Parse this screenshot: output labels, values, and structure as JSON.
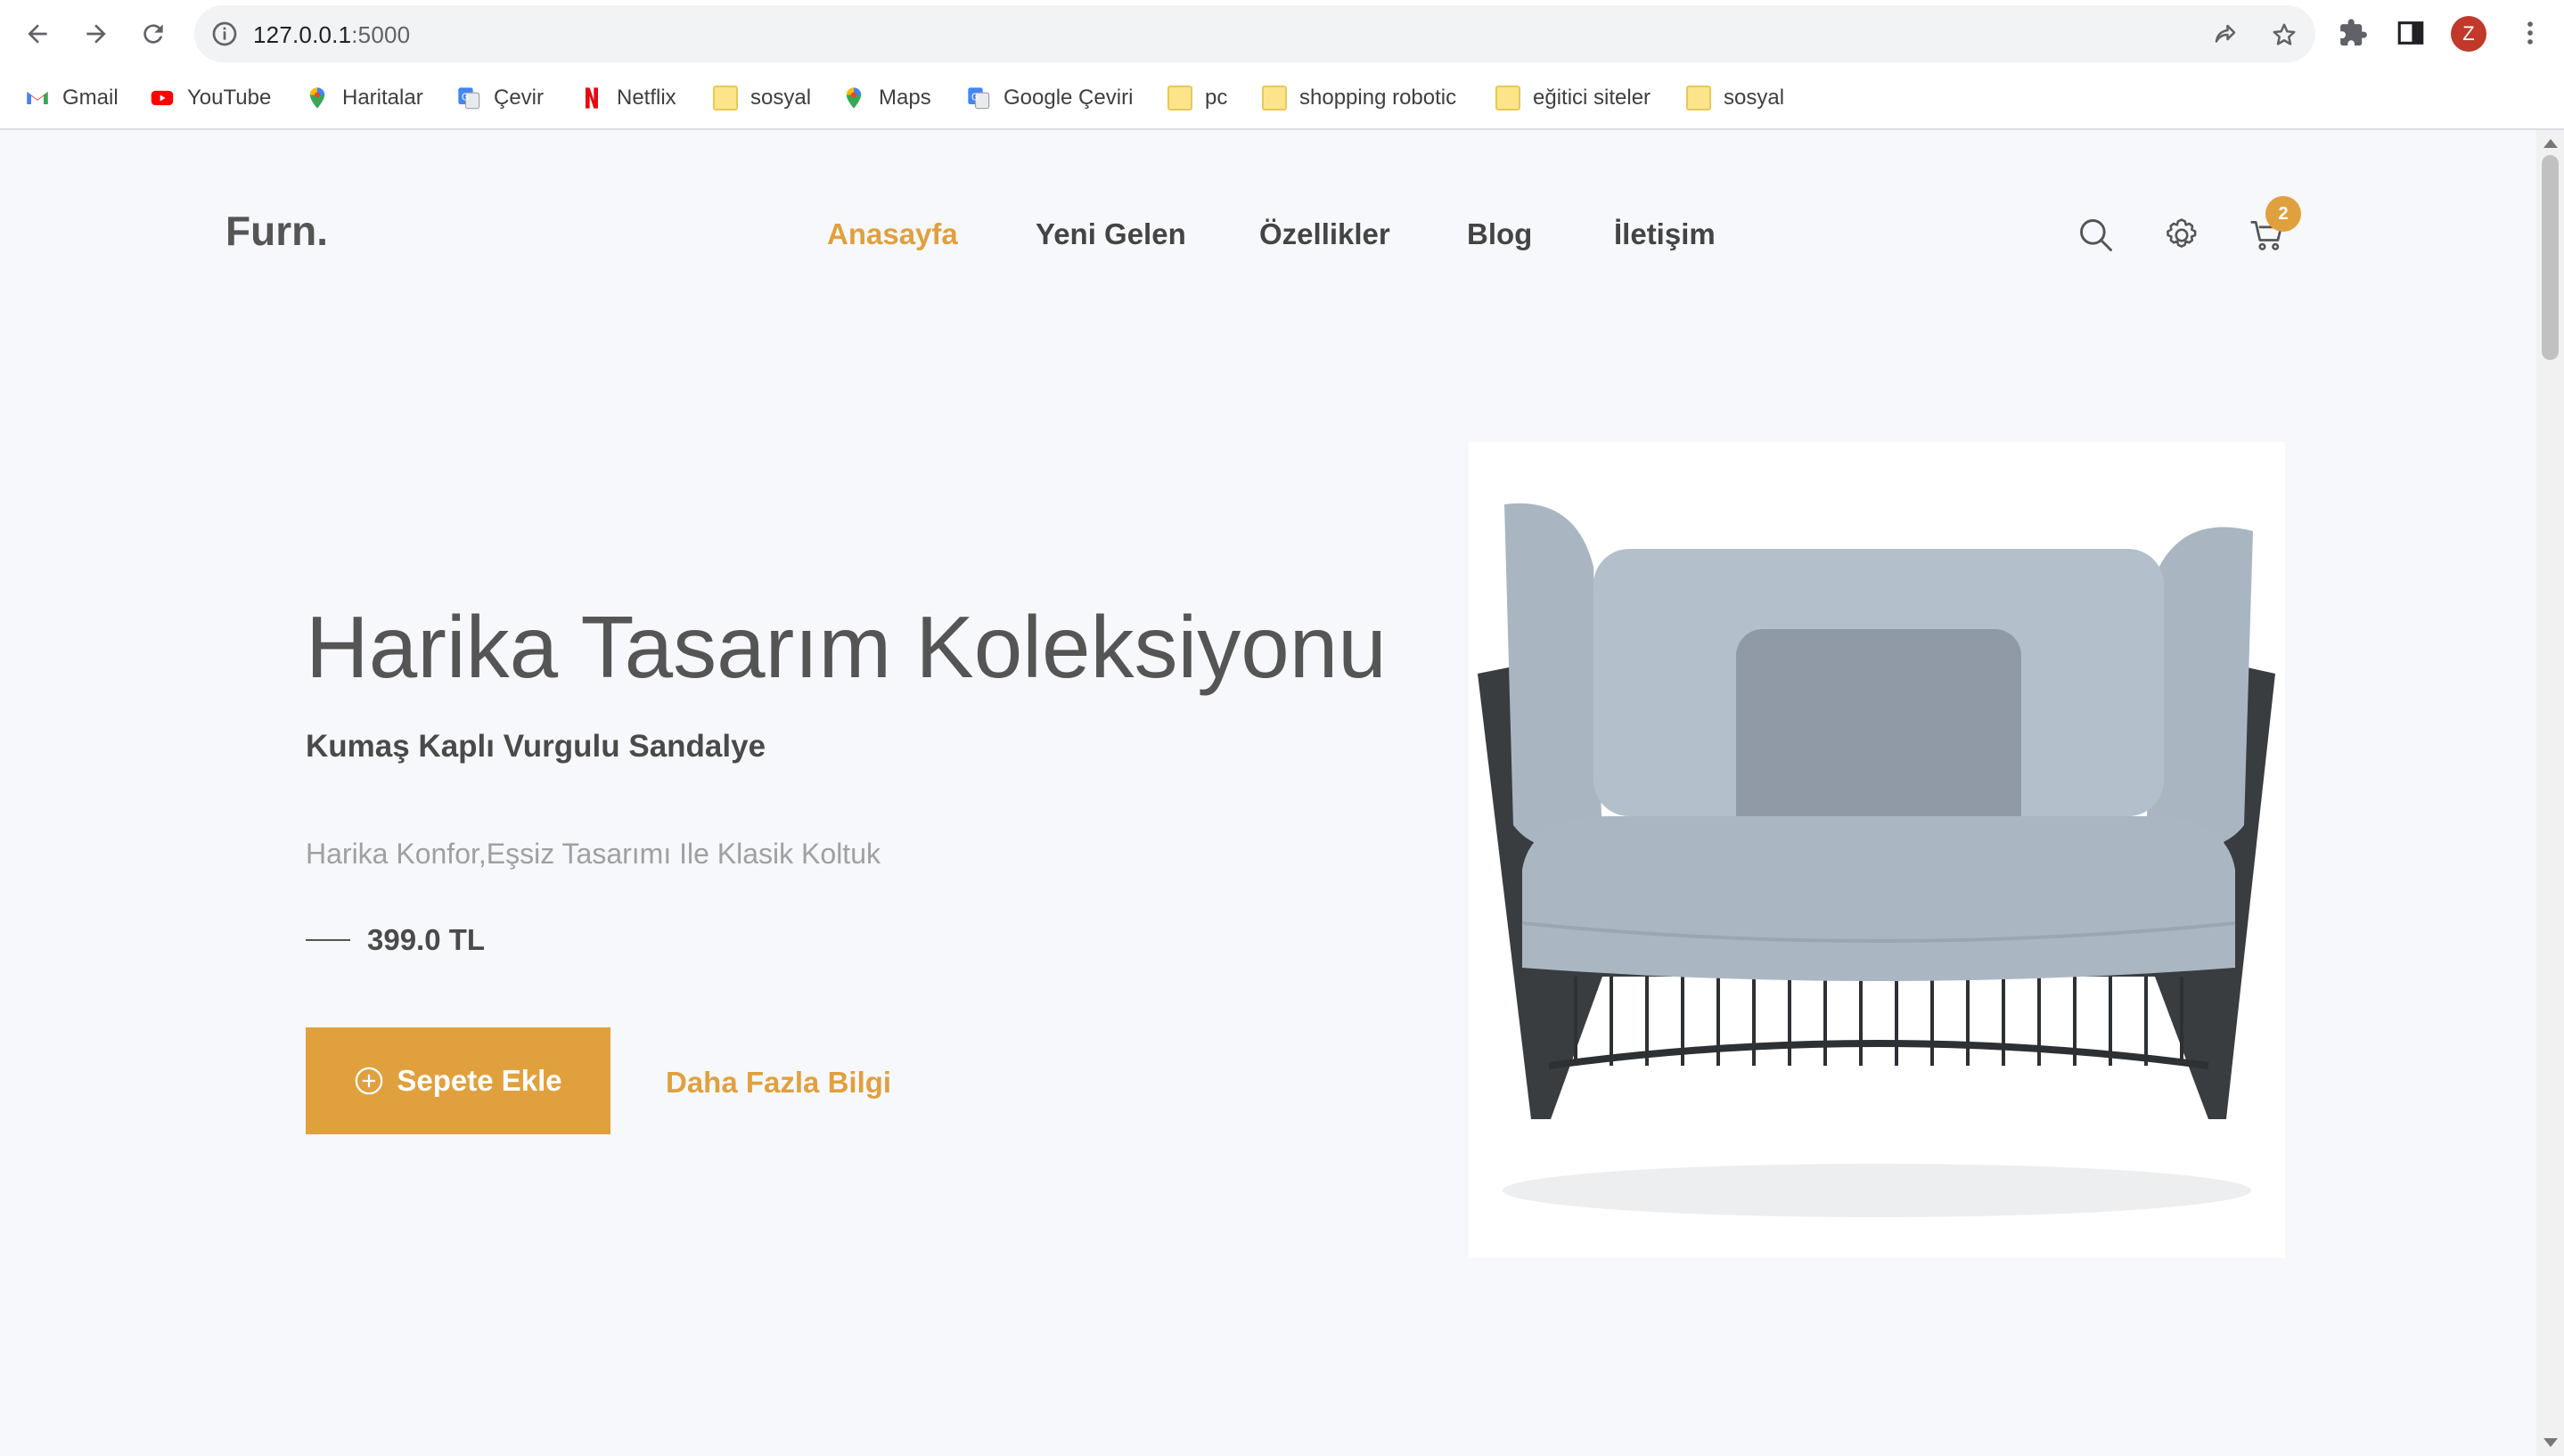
{
  "browser": {
    "url_host": "127.0.0.1",
    "url_port": ":5000",
    "profile_initial": "Z",
    "bookmarks": [
      {
        "label": "Gmail",
        "icon": "gmail-icon"
      },
      {
        "label": "YouTube",
        "icon": "youtube-icon"
      },
      {
        "label": "Haritalar",
        "icon": "maps-pin-icon"
      },
      {
        "label": "Çevir",
        "icon": "translate-icon"
      },
      {
        "label": "Netflix",
        "icon": "netflix-icon"
      },
      {
        "label": "sosyal",
        "icon": "folder-icon"
      },
      {
        "label": "Maps",
        "icon": "maps-pin-icon"
      },
      {
        "label": "Google Çeviri",
        "icon": "translate-icon"
      },
      {
        "label": "pc",
        "icon": "folder-icon"
      },
      {
        "label": "shopping robotic",
        "icon": "folder-icon"
      },
      {
        "label": "eğitici siteler",
        "icon": "folder-icon"
      },
      {
        "label": "sosyal",
        "icon": "folder-icon"
      }
    ]
  },
  "site": {
    "logo": "Furn.",
    "nav": [
      "Anasayfa",
      "Yeni Gelen",
      "Özellikler",
      "Blog",
      "İletişim"
    ],
    "cart_count": "2",
    "accent_color": "#e1a03e"
  },
  "hero": {
    "title": "Harika Tasarım Koleksiyonu",
    "subtitle": "Kumaş Kaplı Vurgulu Sandalye",
    "description": "Harika Konfor,Eşsiz Tasarımı Ile Klasik Koltuk",
    "price": "399.0 TL",
    "add_to_cart": "Sepete Ekle",
    "more_info": "Daha Fazla Bilgi"
  }
}
